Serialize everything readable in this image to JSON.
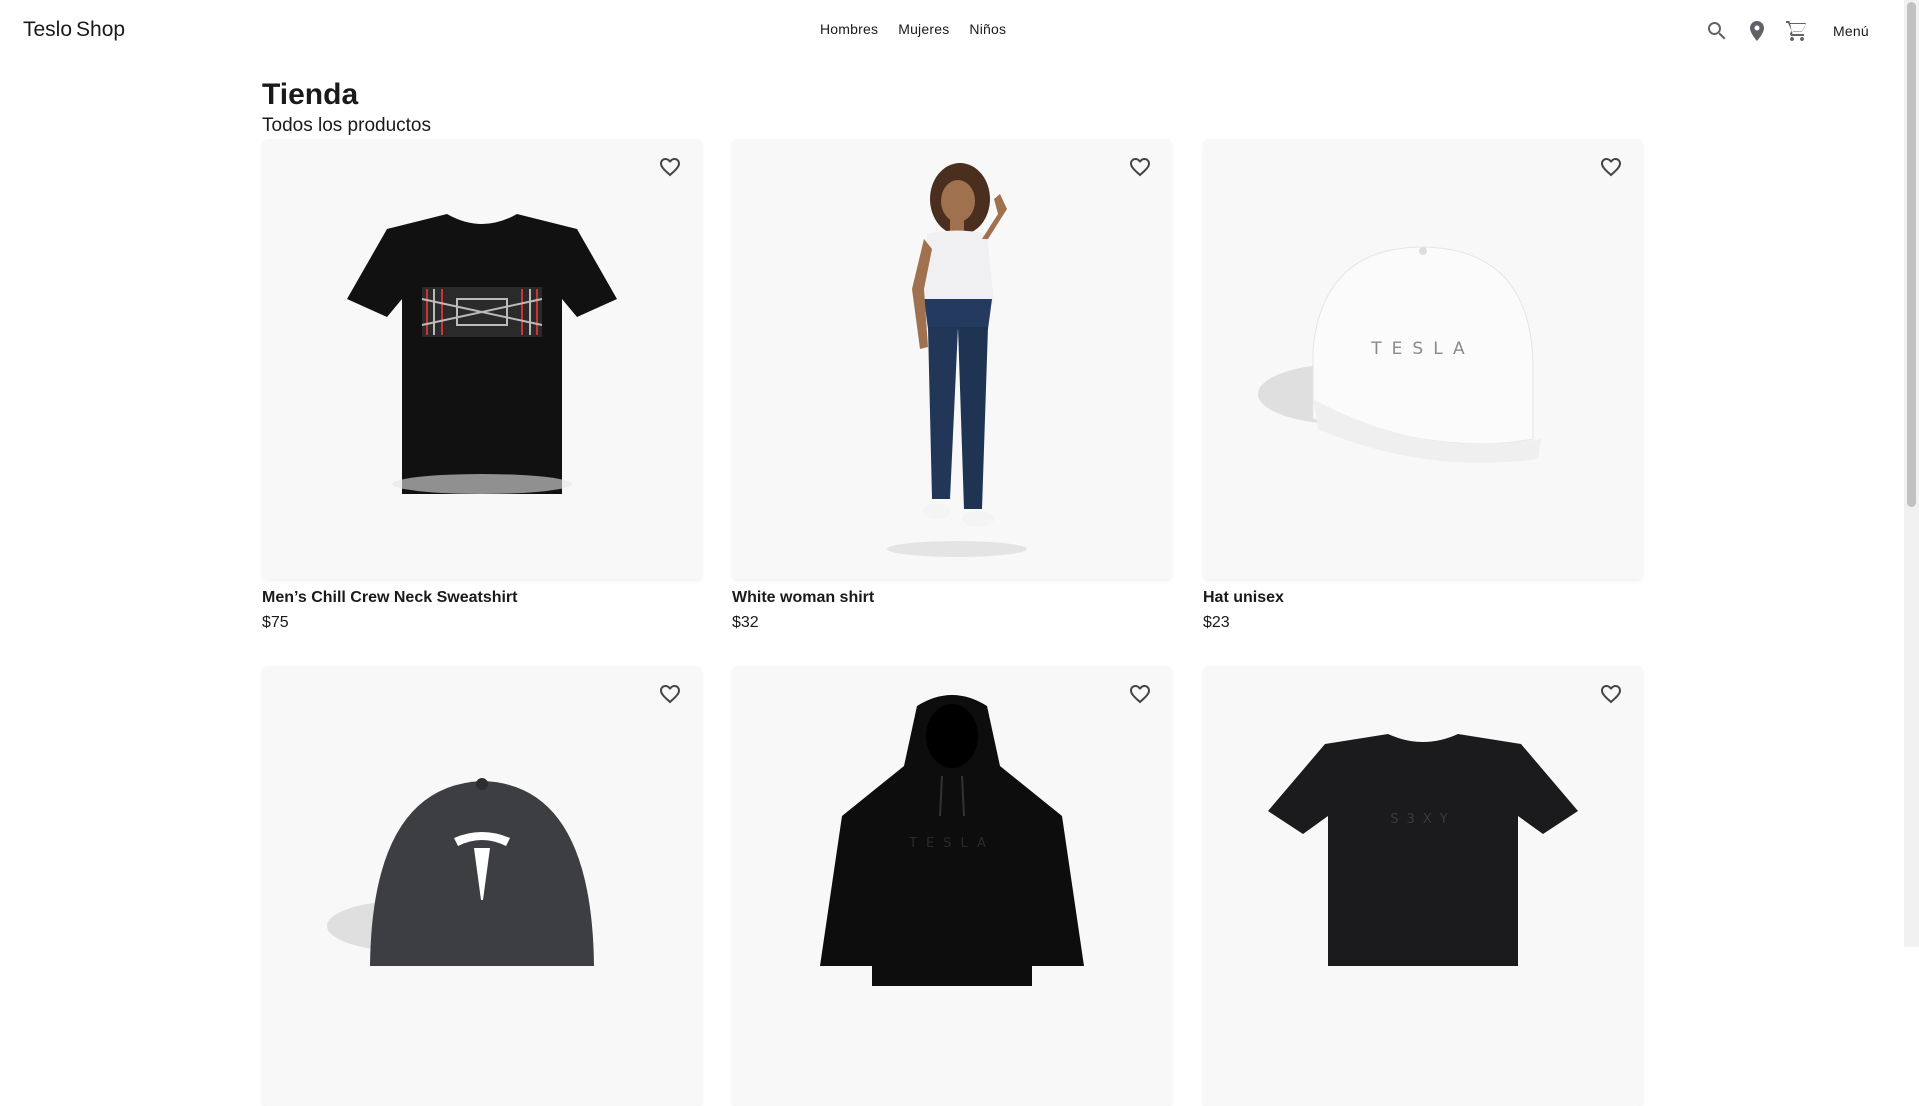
{
  "header": {
    "brand_main": "Teslo",
    "brand_sub": "Shop",
    "nav": [
      "Hombres",
      "Mujeres",
      "Niños"
    ],
    "menu_label": "Menú",
    "icons": [
      "search-icon",
      "location-icon",
      "cart-icon"
    ]
  },
  "page": {
    "title": "Tienda",
    "subtitle": "Todos los productos"
  },
  "products": [
    {
      "name": "Men’s Chill Crew Neck Sweatshirt",
      "price": "$75",
      "image": "black-graphic-tshirt"
    },
    {
      "name": "White woman shirt",
      "price": "$32",
      "image": "woman-white-shirt"
    },
    {
      "name": "Hat unisex",
      "price": "$23",
      "image": "white-tesla-cap"
    },
    {
      "name": "",
      "price": "",
      "image": "gray-tesla-cap"
    },
    {
      "name": "",
      "price": "",
      "image": "black-tesla-hoodie"
    },
    {
      "name": "",
      "price": "",
      "image": "black-s3xy-tshirt"
    }
  ],
  "colors": {
    "background": "#ffffff",
    "card_background": "#f8f8f8",
    "text": "#1a1a1a",
    "icon": "#5f6368"
  }
}
